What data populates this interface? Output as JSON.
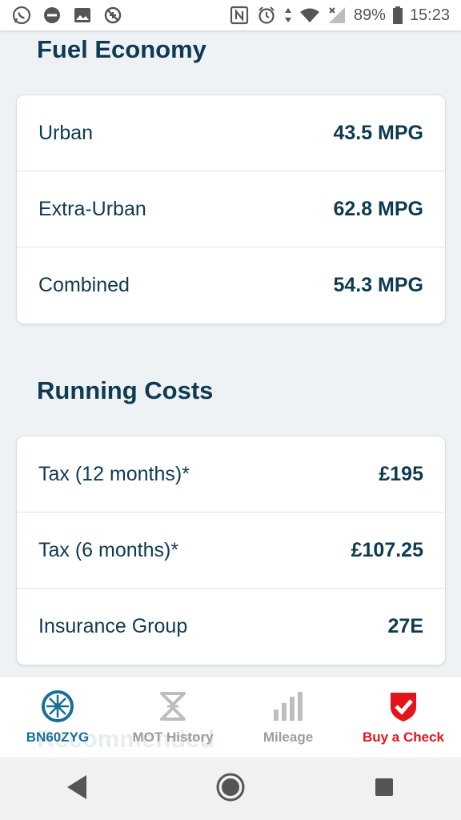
{
  "status_bar": {
    "battery_percent": "89%",
    "time": "15:23",
    "left_icons": [
      "whatsapp-icon",
      "do-not-disturb-icon",
      "gallery-icon",
      "blocked-icon"
    ],
    "right_icons": [
      "nfc-icon",
      "alarm-icon",
      "data-arrows-icon",
      "wifi-icon",
      "signal-icon",
      "battery-icon"
    ]
  },
  "fuel_economy": {
    "title": "Fuel Economy",
    "rows": [
      {
        "label": "Urban",
        "value": "43.5 MPG"
      },
      {
        "label": "Extra-Urban",
        "value": "62.8 MPG"
      },
      {
        "label": "Combined",
        "value": "54.3 MPG"
      }
    ]
  },
  "running_costs": {
    "title": "Running Costs",
    "rows": [
      {
        "label": "Tax (12 months)*",
        "value": "£195"
      },
      {
        "label": "Tax (6 months)*",
        "value": "£107.25"
      },
      {
        "label": "Insurance Group",
        "value": "27E"
      }
    ]
  },
  "next_section_peek": "Recommended",
  "tabs": [
    {
      "label": "BN60ZYG",
      "icon": "wheel-icon",
      "color": "#1a6f94",
      "active": true
    },
    {
      "label": "MOT History",
      "icon": "mot-triangle-icon",
      "color": "#9e9e9e"
    },
    {
      "label": "Mileage",
      "icon": "bar-chart-icon",
      "color": "#9e9e9e"
    },
    {
      "label": "Buy a Check",
      "icon": "shield-check-icon",
      "color": "#e4141b"
    }
  ],
  "system_nav": {
    "back": "back-icon",
    "home": "home-icon",
    "recents": "recents-icon"
  },
  "colors": {
    "text_primary": "#0e3a52",
    "background": "#eef2f4",
    "active_tab": "#1a6f94",
    "accent_red": "#e4141b"
  }
}
